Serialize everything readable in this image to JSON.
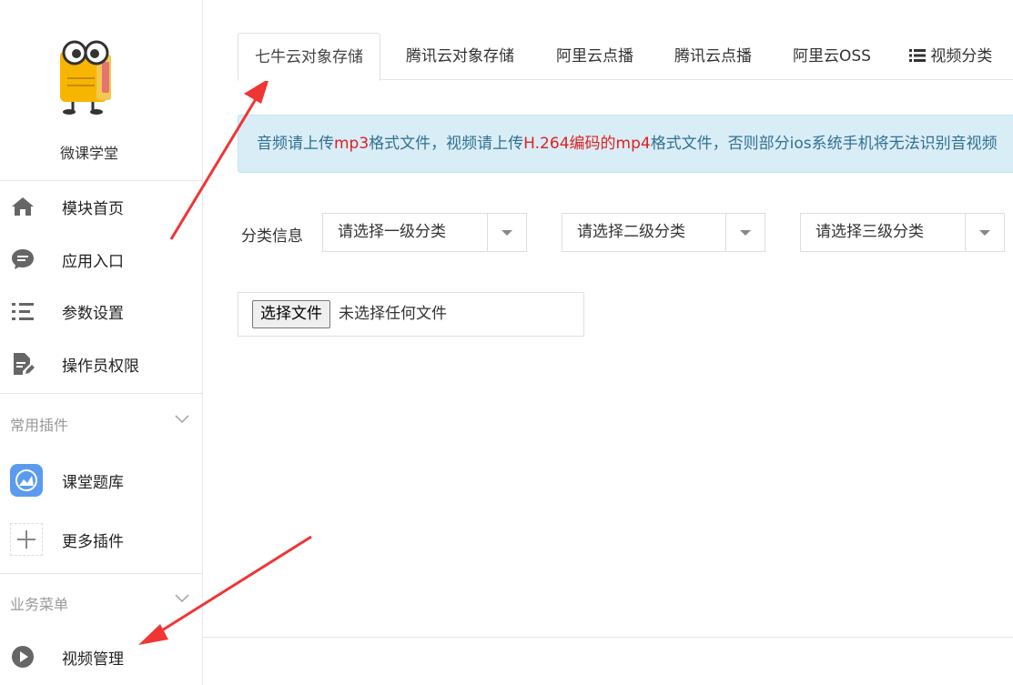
{
  "sidebar": {
    "app_name": "微课学堂",
    "nav": [
      {
        "label": "模块首页",
        "icon": "home-icon"
      },
      {
        "label": "应用入口",
        "icon": "chat-bubble-icon"
      },
      {
        "label": "参数设置",
        "icon": "list-settings-icon"
      },
      {
        "label": "操作员权限",
        "icon": "edit-document-icon"
      }
    ],
    "plugins_title": "常用插件",
    "plugins": [
      {
        "label": "课堂题库",
        "icon": "quiz-app-icon"
      },
      {
        "label": "更多插件",
        "icon": "plus-icon"
      }
    ],
    "business_title": "业务菜单",
    "business": [
      {
        "label": "视频管理",
        "icon": "play-circle-icon"
      }
    ]
  },
  "tabs": [
    {
      "label": "七牛云对象存储",
      "active": true
    },
    {
      "label": "腾讯云对象存储",
      "active": false
    },
    {
      "label": "阿里云点播",
      "active": false
    },
    {
      "label": "腾讯云点播",
      "active": false
    },
    {
      "label": "阿里云OSS",
      "active": false
    },
    {
      "label": "视频分类",
      "active": false,
      "icon": "list-icon"
    }
  ],
  "notice": {
    "p1": "音频请上传",
    "p2": "mp3",
    "p3": "格式文件，视频请上传",
    "p4": "H.264编码的mp4",
    "p5": "格式文件，否则部分ios系统手机将无法识别音视频",
    "highlight_color": "#e02020"
  },
  "category": {
    "label": "分类信息",
    "selects": [
      "请选择一级分类",
      "请选择二级分类",
      "请选择三级分类"
    ]
  },
  "file_input": {
    "button_label": "选择文件",
    "status": "未选择任何文件"
  },
  "colors": {
    "annotation_arrow": "#f03535",
    "notice_bg": "#d9edf7",
    "notice_text": "#31708f"
  }
}
